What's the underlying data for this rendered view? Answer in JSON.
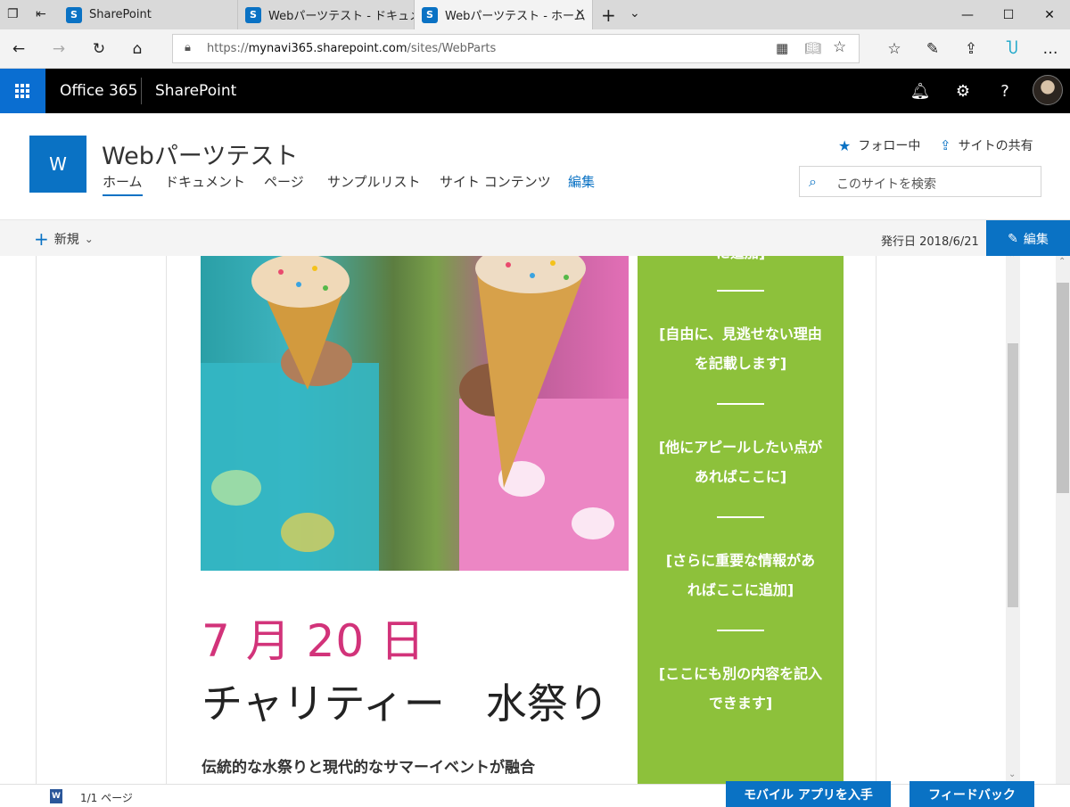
{
  "browser": {
    "tabs": [
      {
        "title": "SharePoint"
      },
      {
        "title": "Webパーツテスト - ドキュメント -"
      },
      {
        "title": "Webパーツテスト - ホーム"
      }
    ],
    "url_prefix": "https://",
    "url_host": "mynavi365.sharepoint.com",
    "url_path": "/sites/WebParts"
  },
  "suite": {
    "app_name": "Office 365",
    "product": "SharePoint"
  },
  "site": {
    "logo_letter": "W",
    "title": "Webパーツテスト",
    "nav": [
      "ホーム",
      "ドキュメント",
      "ページ",
      "サンプルリスト",
      "サイト コンテンツ"
    ],
    "nav_edit": "編集",
    "follow": "フォロー中",
    "share": "サイトの共有",
    "search_placeholder": "このサイトを検索"
  },
  "command": {
    "new_label": "新規",
    "published": "発行日 2018/6/21",
    "edit_label": "編集"
  },
  "content": {
    "date": "7 月 20 日",
    "event": "チャリティー　水祭り",
    "subtitle": "伝統的な水祭りと現代的なサマーイベントが融合",
    "sidebar_top": "に追加]",
    "sidebar_items": [
      {
        "line1": "[自由に、見逃せない理由",
        "line2": "を記載します]"
      },
      {
        "line1": "[他にアピールしたい点が",
        "line2": "あればここに]"
      },
      {
        "line1": "[さらに重要な情報があ",
        "line2": "ればここに追加]"
      },
      {
        "line1": "[ここにも別の内容を記入",
        "line2": "できます]"
      }
    ]
  },
  "status": {
    "pages": "1/1 ページ",
    "mobile_app": "モバイル アプリを入手",
    "feedback": "フィードバック"
  },
  "colors": {
    "brand_blue": "#0a72c4",
    "date_pink": "#d2337a",
    "sidebar_green": "#8dc13b"
  }
}
